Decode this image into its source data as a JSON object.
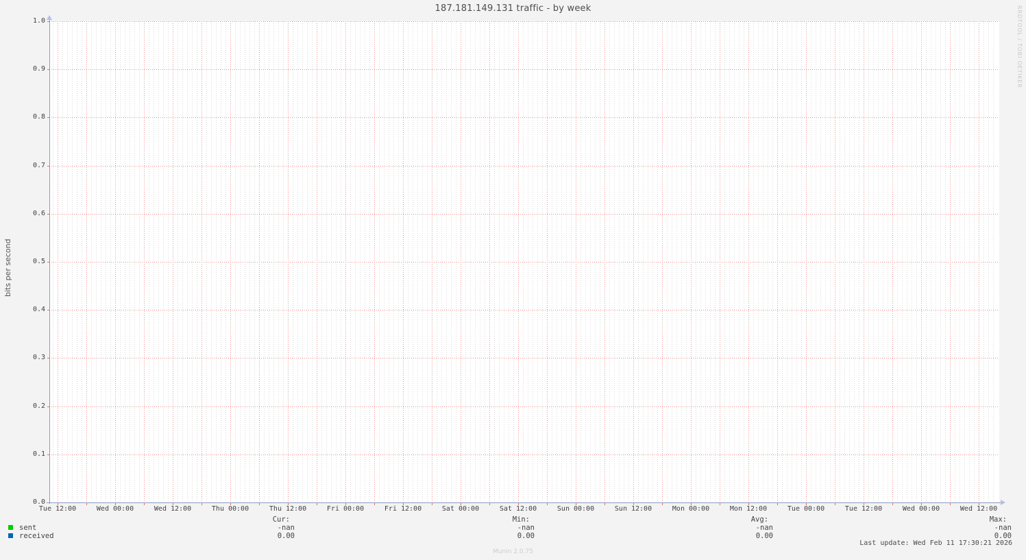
{
  "title": "187.181.149.131 traffic - by week",
  "watermark": "RRDTOOL / TOBI OETIKER",
  "footer": {
    "munin_version": "Munin 2.0.75",
    "last_update": "Last update: Wed Feb 11 17:30:21 2026"
  },
  "chart_data": {
    "type": "line",
    "title": "187.181.149.131 traffic - by week",
    "xlabel": "",
    "ylabel": "bits per second",
    "ylim": [
      0.0,
      1.0
    ],
    "grid": true,
    "legend_position": "bottom",
    "y_ticks": [
      "1.0",
      "0.9",
      "0.8",
      "0.7",
      "0.6",
      "0.5",
      "0.4",
      "0.3",
      "0.2",
      "0.1",
      "0.0"
    ],
    "x_ticks": [
      "Tue 12:00",
      "Wed 00:00",
      "Wed 12:00",
      "Thu 00:00",
      "Thu 12:00",
      "Fri 00:00",
      "Fri 12:00",
      "Sat 00:00",
      "Sat 12:00",
      "Sun 00:00",
      "Sun 12:00",
      "Mon 00:00",
      "Mon 12:00",
      "Tue 00:00",
      "Tue 12:00",
      "Wed 00:00",
      "Wed 12:00"
    ],
    "stat_columns": [
      "Cur:",
      "Min:",
      "Avg:",
      "Max:"
    ],
    "series": [
      {
        "name": "sent",
        "color": "#00cc00",
        "values": [],
        "stats": {
          "cur": "-nan",
          "min": "-nan",
          "avg": "-nan",
          "max": "-nan"
        }
      },
      {
        "name": "received",
        "color": "#0066b3",
        "values": [],
        "stats": {
          "cur": "0.00",
          "min": "0.00",
          "avg": "0.00",
          "max": "0.00"
        }
      }
    ]
  },
  "colors": {
    "background": "#f3f3f3",
    "plot_background": "#ffffff",
    "major_grid": "#ef9090",
    "minor_grid": "#dadada",
    "axis": "#8d9ac1",
    "arrow": "#b7bfe8",
    "sent": "#00cc00",
    "received": "#0066b3"
  }
}
